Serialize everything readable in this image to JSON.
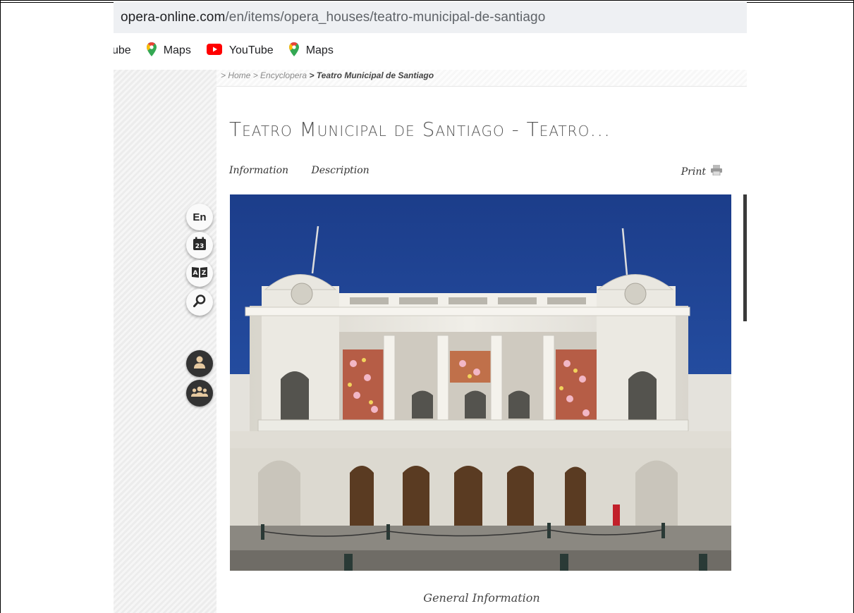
{
  "browser": {
    "url_domain": "opera-online.com",
    "url_path": "/en/items/opera_houses/teatro-municipal-de-santiago"
  },
  "bookmarks": [
    {
      "label": "ube",
      "icon": "youtube-icon"
    },
    {
      "label": "Maps",
      "icon": "maps-pin-icon"
    },
    {
      "label": "YouTube",
      "icon": "youtube-icon"
    },
    {
      "label": "Maps",
      "icon": "maps-pin-icon"
    }
  ],
  "breadcrumb": {
    "home": "> Home",
    "section": "> Encyclopera",
    "current": "> Teatro Municipal de Santiago"
  },
  "page": {
    "title": "Teatro Municipal de Santiago - Teatro...",
    "tabs": [
      "Information",
      "Description"
    ],
    "print_label": "Print",
    "section_heading": "General Information"
  },
  "side_buttons": [
    {
      "label": "En",
      "icon": "language-icon"
    },
    {
      "label": "23",
      "icon": "calendar-icon"
    },
    {
      "label": "A|Z",
      "icon": "dictionary-icon"
    },
    {
      "label": "",
      "icon": "search-icon"
    },
    {
      "label": "",
      "icon": "user-icon"
    },
    {
      "label": "",
      "icon": "community-icon"
    }
  ],
  "colors": {
    "sky": "#1a3f8f",
    "facade": "#e8e6df",
    "youtube_red": "#ff0000",
    "maps_green": "#34a853"
  }
}
